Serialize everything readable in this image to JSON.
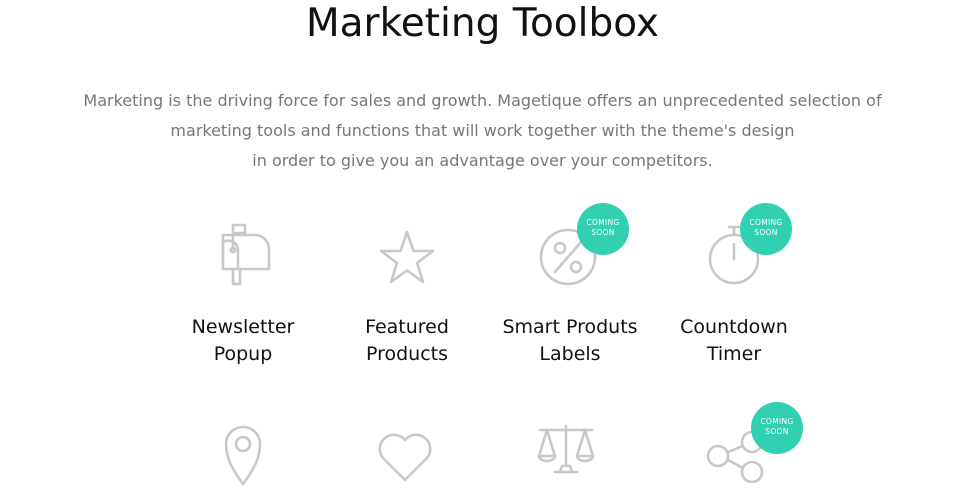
{
  "header": {
    "title": "Marketing Toolbox"
  },
  "intro": {
    "line1": "Marketing is the driving force for sales and growth. Magetique offers an unprecedented selection of",
    "line2": "marketing tools and functions that will work together with the theme's design",
    "line3": "in order to give you an advantage over your competitors."
  },
  "features": [
    {
      "icon": "mailbox-icon",
      "label_line1": "Newsletter",
      "label_line2": "Popup"
    },
    {
      "icon": "star-icon",
      "label_line1": "Featured",
      "label_line2": "Products"
    },
    {
      "icon": "percent-icon",
      "label_line1": "Smart Produts",
      "label_line2": "Labels",
      "badge_line1": "COMING",
      "badge_line2": "SOON"
    },
    {
      "icon": "stopwatch-icon",
      "label_line1": "Countdown",
      "label_line2": "Timer",
      "badge_line1": "COMING",
      "badge_line2": "SOON"
    },
    {
      "icon": "map-pin-icon"
    },
    {
      "icon": "heart-icon"
    },
    {
      "icon": "scales-icon"
    },
    {
      "icon": "share-icon",
      "badge_line1": "COMING",
      "badge_line2": "SOON"
    }
  ],
  "colors": {
    "accent": "#31d0b1",
    "icon": "#c8c8c8",
    "heading": "#111111",
    "body_text": "#777777"
  }
}
